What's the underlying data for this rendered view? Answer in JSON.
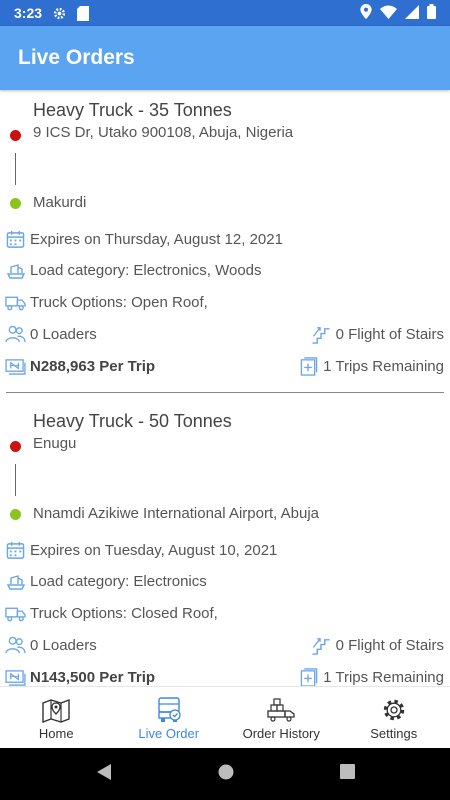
{
  "status_bar": {
    "time": "3:23"
  },
  "app_bar": {
    "title": "Live Orders"
  },
  "orders": [
    {
      "truck": "Heavy Truck - 35 Tonnes",
      "pickup": "9 ICS Dr, Utako 900108, Abuja, Nigeria",
      "dropoff": "Makurdi",
      "expires": "Expires on Thursday, August 12, 2021",
      "load_category": "Load category: Electronics, Woods",
      "truck_options": "Truck Options: Open Roof,",
      "loaders": "0 Loaders",
      "stairs": "0 Flight of Stairs",
      "price": "N288,963 Per Trip",
      "trips": "1 Trips Remaining"
    },
    {
      "truck": "Heavy Truck - 50 Tonnes",
      "pickup": "Enugu",
      "dropoff": "Nnamdi Azikiwe International Airport, Abuja",
      "expires": "Expires on Tuesday, August 10, 2021",
      "load_category": "Load category: Electronics",
      "truck_options": "Truck Options: Closed Roof,",
      "loaders": "0 Loaders",
      "stairs": "0 Flight of Stairs",
      "price": "N143,500 Per Trip",
      "trips": "1 Trips Remaining"
    }
  ],
  "bottom_nav": [
    {
      "label": "Home",
      "icon": "map-icon"
    },
    {
      "label": "Live Order",
      "icon": "live-truck-icon",
      "active": true
    },
    {
      "label": "Order History",
      "icon": "delivery-truck-icon"
    },
    {
      "label": "Settings",
      "icon": "gear-icon"
    }
  ],
  "colors": {
    "status_bar": "#2e6fcf",
    "app_bar": "#5aa4f2",
    "pickup_dot": "#cc1111",
    "dropoff_dot": "#8cc41f",
    "accent": "#3d87e6",
    "icon_blue": "#6aa5e8"
  }
}
